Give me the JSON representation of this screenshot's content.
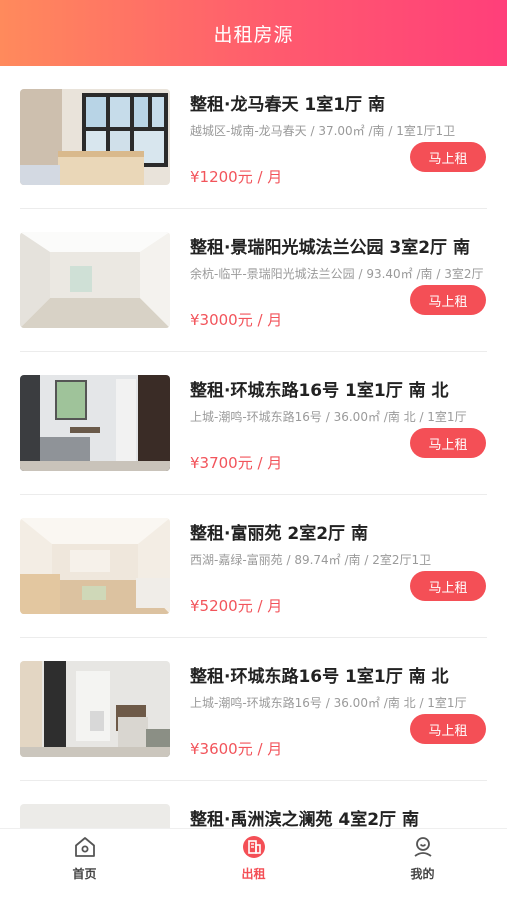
{
  "header": {
    "title": "出租房源"
  },
  "listings": [
    {
      "title": "整租·龙马春天 1室1厅 南",
      "desc": "越城区-城南-龙马春天 / 37.00㎡ /南 / 1室1厅1卫",
      "price": "¥1200元 / 月",
      "button": "马上租"
    },
    {
      "title": "整租·景瑞阳光城法兰公园 3室2厅 南",
      "desc": "余杭-临平-景瑞阳光城法兰公园 / 93.40㎡ /南 / 3室2厅",
      "price": "¥3000元 / 月",
      "button": "马上租"
    },
    {
      "title": "整租·环城东路16号 1室1厅 南 北",
      "desc": "上城-潮鸣-环城东路16号 / 36.00㎡ /南 北 / 1室1厅",
      "price": "¥3700元 / 月",
      "button": "马上租"
    },
    {
      "title": "整租·富丽苑 2室2厅 南",
      "desc": "西湖-嘉绿-富丽苑 / 89.74㎡ /南 / 2室2厅1卫",
      "price": "¥5200元 / 月",
      "button": "马上租"
    },
    {
      "title": "整租·环城东路16号 1室1厅 南 北",
      "desc": "上城-潮鸣-环城东路16号 / 36.00㎡ /南 北 / 1室1厅",
      "price": "¥3600元 / 月",
      "button": "马上租"
    },
    {
      "title": "整租·禹洲滨之澜苑 4室2厅 南",
      "desc": "",
      "price": "",
      "button": ""
    }
  ],
  "tabbar": {
    "home": {
      "label": "首页",
      "icon": "home-icon"
    },
    "rent": {
      "label": "出租",
      "icon": "building-icon"
    },
    "mine": {
      "label": "我的",
      "icon": "user-icon"
    }
  },
  "colors": {
    "accent": "#f44f56",
    "header_start": "#ff8a5c",
    "header_end": "#ff3f7a"
  }
}
